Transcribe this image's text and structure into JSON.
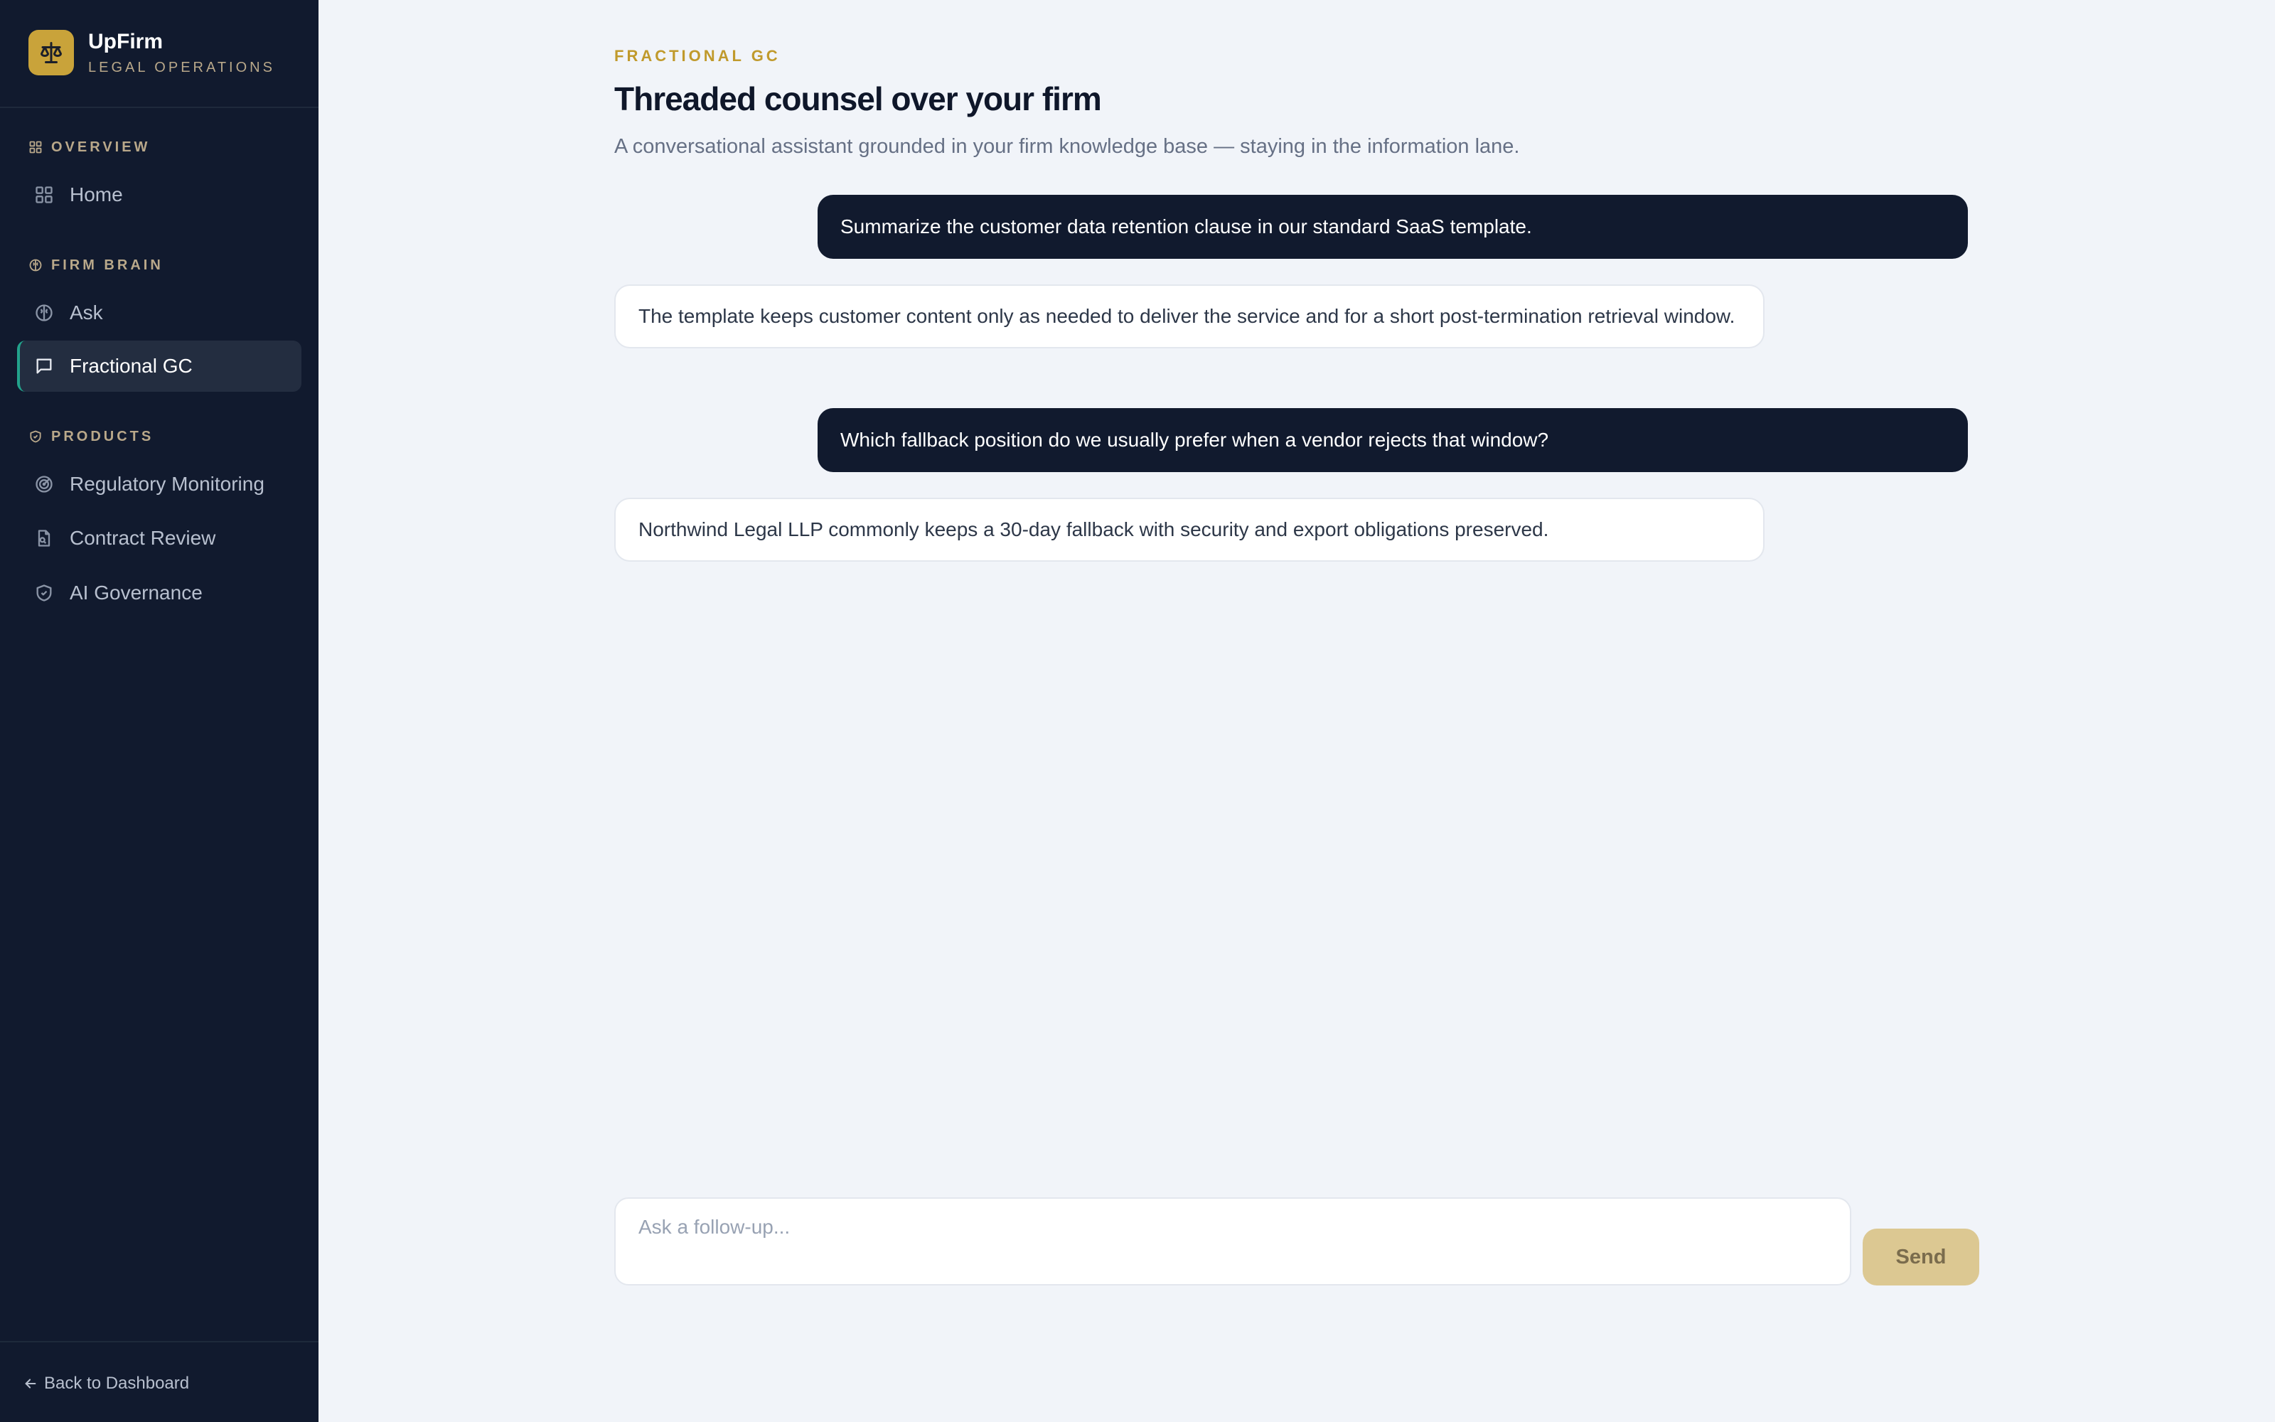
{
  "brand": {
    "name": "UpFirm",
    "subtitle": "LEGAL OPERATIONS",
    "logo_icon": "scale-icon",
    "accent_color": "#c9a33a"
  },
  "sidebar": {
    "sections": [
      {
        "label": "OVERVIEW",
        "icon": "grid-icon",
        "items": [
          {
            "label": "Home",
            "icon": "grid-icon"
          }
        ]
      },
      {
        "label": "FIRM BRAIN",
        "icon": "brain-icon",
        "items": [
          {
            "label": "Ask",
            "icon": "brain-icon"
          },
          {
            "label": "Fractional GC",
            "icon": "chat-bubble-icon",
            "active": true
          }
        ]
      },
      {
        "label": "PRODUCTS",
        "icon": "shield-icon",
        "items": [
          {
            "label": "Regulatory Monitoring",
            "icon": "radar-icon"
          },
          {
            "label": "Contract Review",
            "icon": "document-search-icon"
          },
          {
            "label": "AI Governance",
            "icon": "shield-check-icon"
          }
        ]
      }
    ],
    "footer": {
      "back_label": "Back to Dashboard",
      "icon": "arrow-left-icon"
    },
    "active_indicator_color": "#22a38c"
  },
  "main": {
    "eyebrow": "FRACTIONAL GC",
    "title": "Threaded counsel over your firm",
    "subtitle": "A conversational assistant grounded in your firm knowledge base — staying in the information lane.",
    "messages": [
      {
        "role": "user",
        "text": "Summarize the customer data retention clause in our standard SaaS template."
      },
      {
        "role": "assistant",
        "text": "The template keeps customer content only as needed to deliver the service and for a short post-termination retrieval window."
      },
      {
        "role": "user",
        "text": "Which fallback position do we usually prefer when a vendor rejects that window?"
      },
      {
        "role": "assistant",
        "text": "Northwind Legal LLP commonly keeps a 30-day fallback with security and export obligations preserved."
      }
    ],
    "composer": {
      "placeholder": "Ask a follow-up...",
      "value": "",
      "send_label": "Send"
    }
  }
}
